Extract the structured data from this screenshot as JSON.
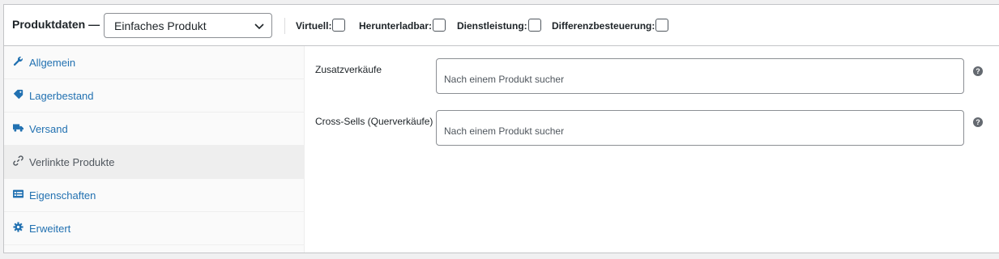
{
  "header": {
    "title": "Produktdaten —",
    "product_type": "Einfaches Produkt",
    "options": [
      {
        "label": "Virtuell:"
      },
      {
        "label": "Herunterladbar:"
      },
      {
        "label": "Dienstleistung:"
      },
      {
        "label": "Differenzbesteuerung:"
      }
    ]
  },
  "tabs": [
    {
      "label": "Allgemein",
      "icon": "wrench-icon"
    },
    {
      "label": "Lagerbestand",
      "icon": "tag-icon"
    },
    {
      "label": "Versand",
      "icon": "truck-icon"
    },
    {
      "label": "Verlinkte Produkte",
      "icon": "link-icon",
      "active": true
    },
    {
      "label": "Eigenschaften",
      "icon": "list-icon"
    },
    {
      "label": "Erweitert",
      "icon": "gear-icon"
    }
  ],
  "fields": [
    {
      "label": "Zusatzverkäufe",
      "placeholder": "Nach einem Produkt sucher",
      "help": "?"
    },
    {
      "label": "Cross-Sells (Querverkäufe)",
      "placeholder": "Nach einem Produkt sucher",
      "help": "?"
    }
  ],
  "colors": {
    "link": "#2271b1",
    "active_tab_bg": "#eeeeee",
    "border": "#c3c4c7"
  }
}
